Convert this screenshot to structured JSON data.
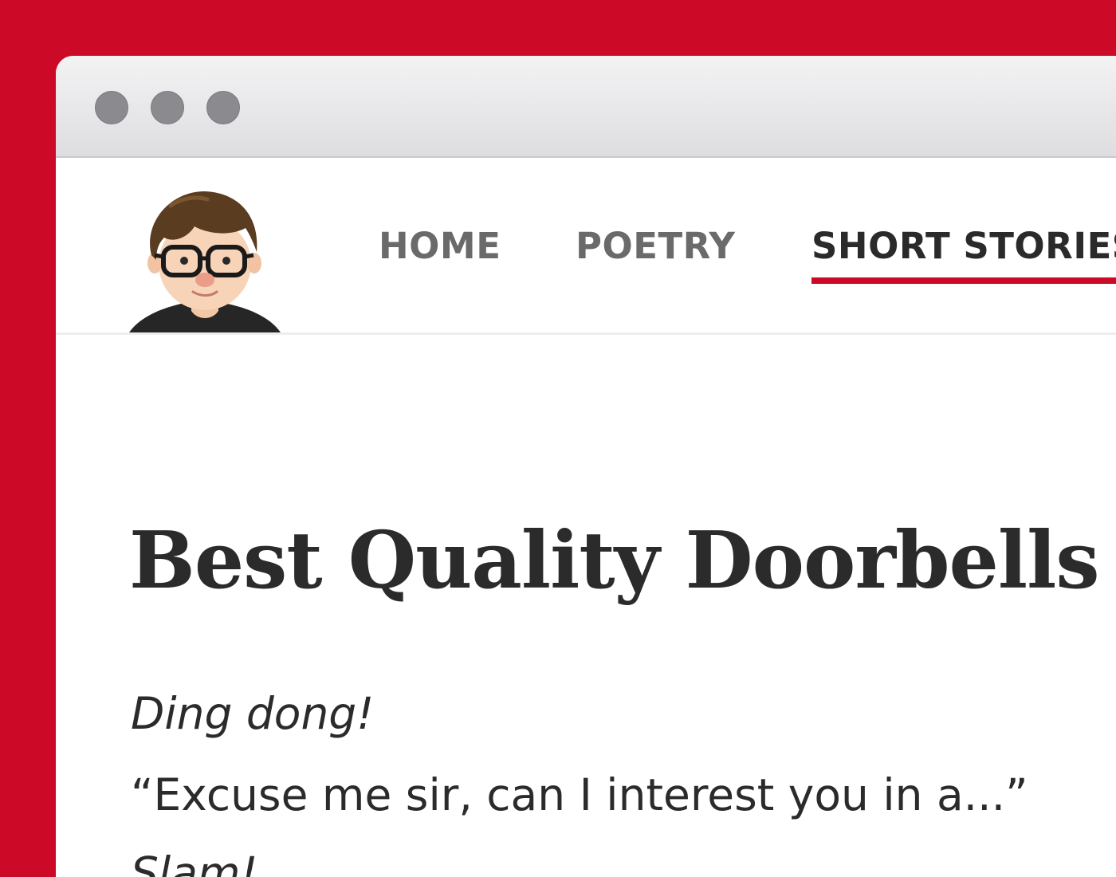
{
  "window": {
    "controls": [
      "close-button",
      "minimize-button",
      "zoom-button"
    ]
  },
  "header": {
    "avatar_icon": "cartoon-person-with-glasses-avatar",
    "nav": [
      {
        "label": "HOME",
        "active": false
      },
      {
        "label": "POETRY",
        "active": false
      },
      {
        "label": "SHORT STORIES",
        "active": true
      }
    ]
  },
  "article": {
    "title": "Best Quality Doorbells",
    "lines": [
      "Ding dong!",
      "“Excuse me sir, can I interest you in a...”",
      "Slam!"
    ]
  },
  "colors": {
    "accent": "#cc0a28",
    "nav_text": "#6a6a6a",
    "nav_active_text": "#2a2a2a",
    "body_text": "#2b2b2b"
  }
}
